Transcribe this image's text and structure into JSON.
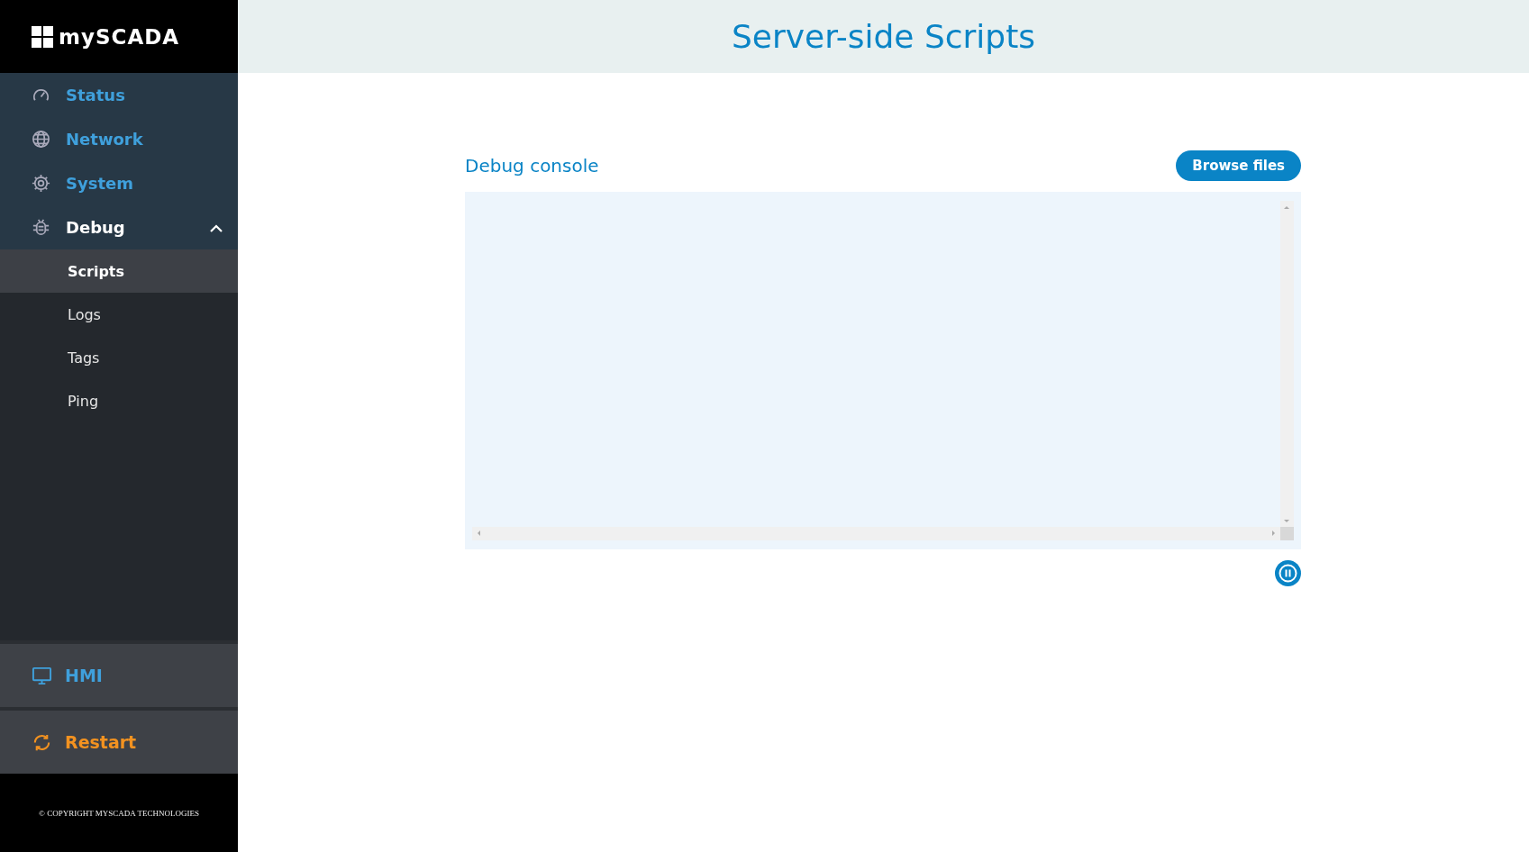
{
  "brand": {
    "name": "mySCADA"
  },
  "nav": [
    {
      "kind": "gauge",
      "label": "Status",
      "active": false
    },
    {
      "kind": "globe",
      "label": "Network",
      "active": false
    },
    {
      "kind": "gear",
      "label": "System",
      "active": false
    },
    {
      "kind": "bug",
      "label": "Debug",
      "active": true,
      "expanded": true,
      "children": [
        {
          "label": "Scripts",
          "selected": true
        },
        {
          "label": "Logs",
          "selected": false
        },
        {
          "label": "Tags",
          "selected": false
        },
        {
          "label": "Ping",
          "selected": false
        }
      ]
    }
  ],
  "hmi": {
    "label": "HMI"
  },
  "restart": {
    "label": "Restart"
  },
  "copyright": "© COPYRIGHT MYSCADA TECHNOLOGIES",
  "header": {
    "title": "Server-side Scripts"
  },
  "console": {
    "title": "Debug console",
    "browse_button": "Browse files"
  }
}
